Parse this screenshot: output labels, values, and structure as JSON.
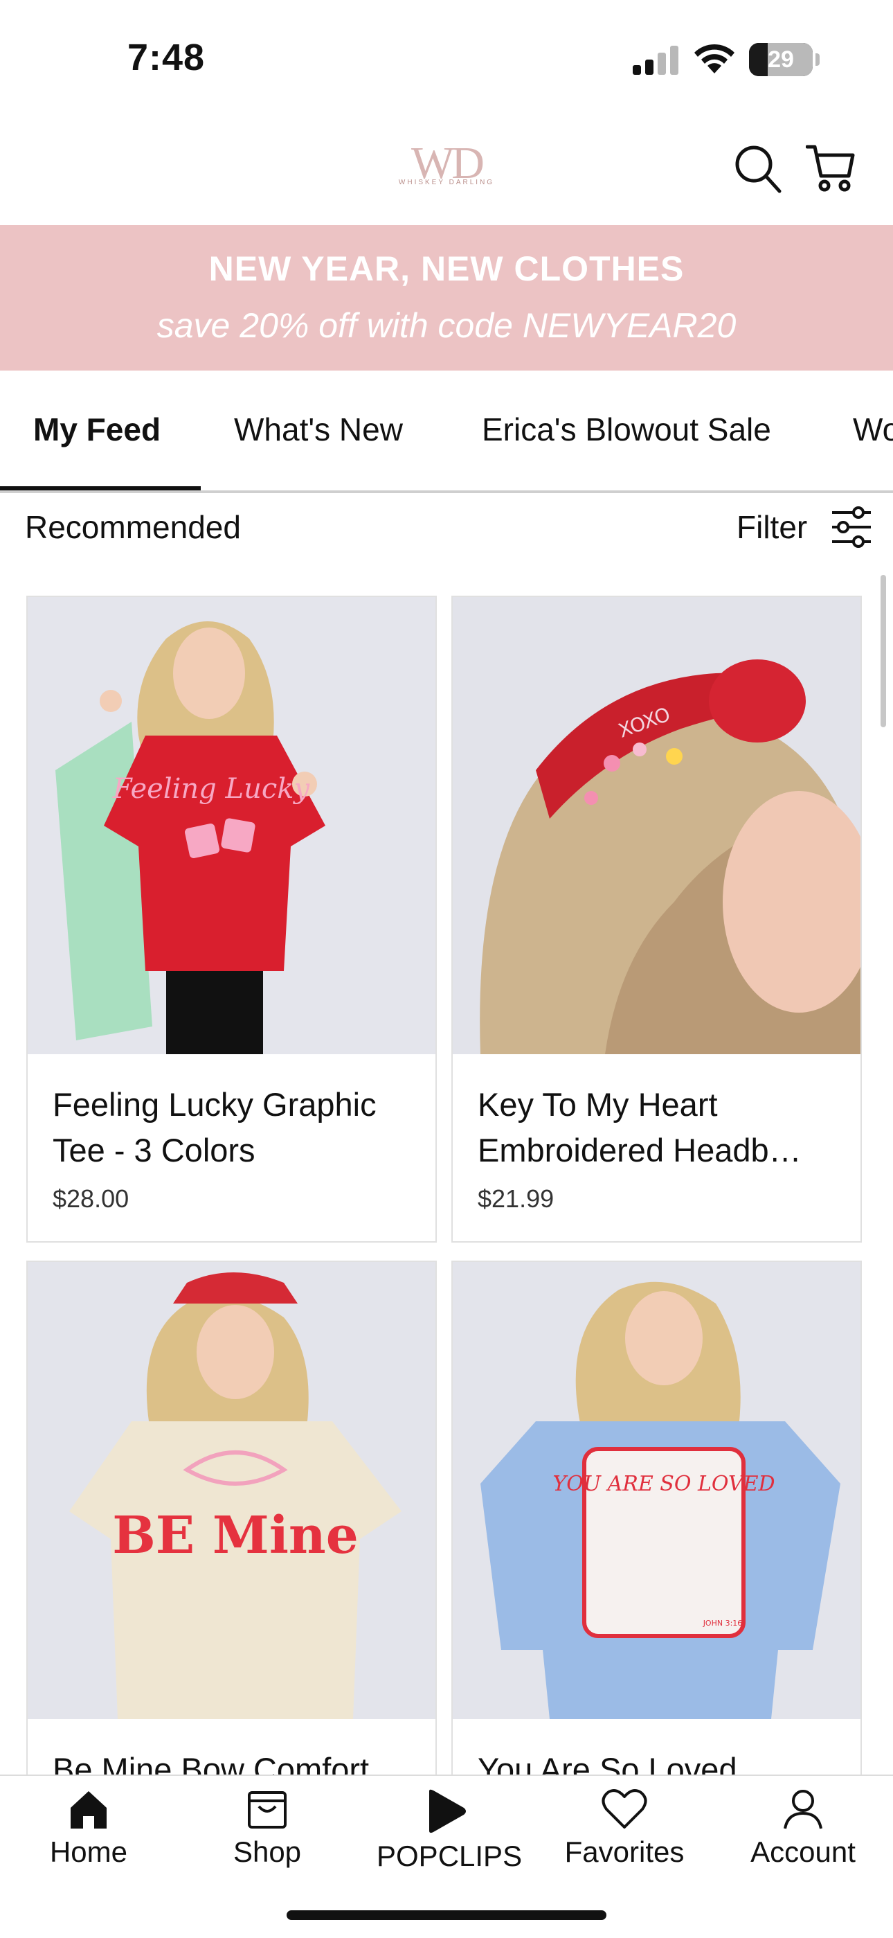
{
  "status_bar": {
    "time": "7:48",
    "battery": "29",
    "battery_level_percent": 29,
    "icons": [
      "cellular-signal-icon",
      "wifi-icon",
      "battery-icon"
    ]
  },
  "header": {
    "logo_mark": "WD",
    "logo_text": "WHISKEY DARLING",
    "icons": [
      "search-icon",
      "cart-icon"
    ]
  },
  "promo": {
    "title": "NEW YEAR, NEW CLOTHES",
    "subtitle": "save 20% off with code NEWYEAR20",
    "background": "#ecc3c4"
  },
  "tabs": [
    {
      "label": "My Feed",
      "active": true
    },
    {
      "label": "What's New",
      "active": false
    },
    {
      "label": "Erica's Blowout Sale",
      "active": false
    },
    {
      "label": "Wo",
      "active": false
    }
  ],
  "section": {
    "title": "Recommended",
    "filter_label": "Filter"
  },
  "products": [
    {
      "line1": "Feeling Lucky Graphic",
      "line2": "Tee - 3 Colors",
      "price": "$28.00",
      "image_text": "Feeling Lucky"
    },
    {
      "line1": "Key To My Heart",
      "line2": "Embroidered Headb…",
      "price": "$21.99",
      "image_text": "XOXO"
    },
    {
      "line1": "Be Mine Bow Comfort",
      "line2": "",
      "price": "",
      "image_text": "BE Mine"
    },
    {
      "line1": "You Are So Loved",
      "line2": "",
      "price": "",
      "image_text": "YOU ARE SO LOVED",
      "image_text_small": "JOHN 3:16"
    }
  ],
  "bottom_nav": [
    {
      "label": "Home",
      "icon": "home-icon"
    },
    {
      "label": "Shop",
      "icon": "shop-bag-icon"
    },
    {
      "label": "POPCLIPS",
      "icon": "play-icon"
    },
    {
      "label": "Favorites",
      "icon": "heart-icon"
    },
    {
      "label": "Account",
      "icon": "account-icon"
    }
  ],
  "colors": {
    "accent_pink": "#ecc3c4",
    "logo": "#d8b5b3",
    "text": "#111111"
  }
}
